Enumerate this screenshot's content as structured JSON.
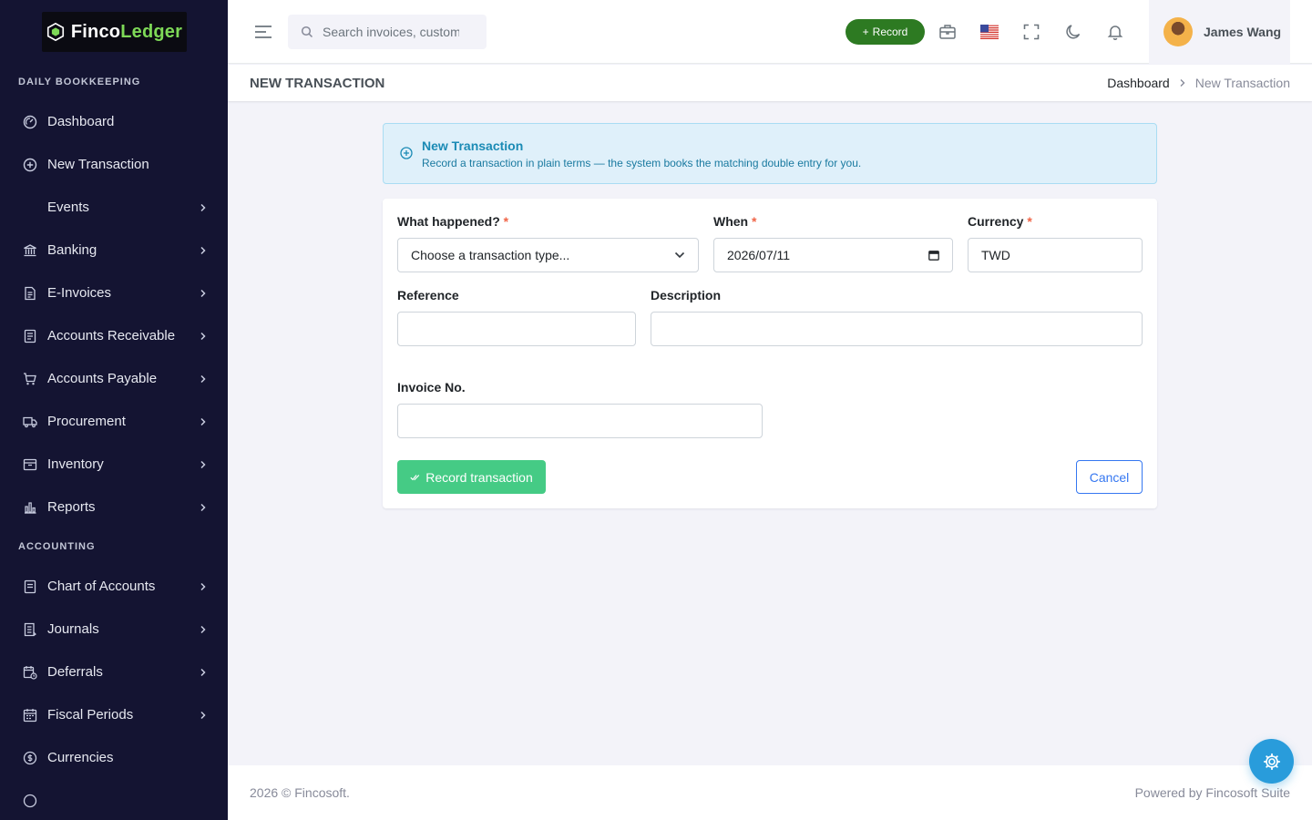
{
  "brand": {
    "name_part1": "Finco",
    "name_part2": "Ledger"
  },
  "sidebar": {
    "section_daily": "Daily Bookkeeping",
    "section_accounting": "Accounting",
    "items": [
      {
        "label": "Dashboard",
        "icon": "dashboard-icon"
      },
      {
        "label": "New Transaction",
        "icon": "plus-circle-icon"
      },
      {
        "label": "Events",
        "icon": ""
      },
      {
        "label": "Banking",
        "icon": "bank-icon"
      },
      {
        "label": "E-Invoices",
        "icon": "document-icon"
      },
      {
        "label": "Accounts Receivable",
        "icon": "receipt-icon"
      },
      {
        "label": "Accounts Payable",
        "icon": "cart-icon"
      },
      {
        "label": "Procurement",
        "icon": "truck-icon"
      },
      {
        "label": "Inventory",
        "icon": "archive-icon"
      },
      {
        "label": "Reports",
        "icon": "bar-chart-icon"
      },
      {
        "label": "Chart of Accounts",
        "icon": "ledger-icon"
      },
      {
        "label": "Journals",
        "icon": "journal-icon"
      },
      {
        "label": "Deferrals",
        "icon": "calendar-clock-icon"
      },
      {
        "label": "Fiscal Periods",
        "icon": "calendar-icon"
      },
      {
        "label": "Currencies",
        "icon": "coin-icon"
      }
    ]
  },
  "topbar": {
    "search_placeholder": "Search invoices, customers...",
    "record_label": "Record",
    "user_name": "James Wang"
  },
  "page": {
    "title": "New Transaction",
    "breadcrumb_home": "Dashboard",
    "breadcrumb_current": "New Transaction"
  },
  "alert": {
    "title": "New Transaction",
    "text": "Record a transaction in plain terms — the system books the matching double entry for you."
  },
  "form": {
    "what_label": "What happened?",
    "what_value": "Choose a transaction type...",
    "when_label": "When",
    "when_value": "2026/07/11",
    "currency_label": "Currency",
    "currency_value": "TWD",
    "reference_label": "Reference",
    "description_label": "Description",
    "invoice_label": "Invoice No.",
    "required_mark": "*",
    "submit_label": "Record transaction",
    "cancel_label": "Cancel"
  },
  "footer": {
    "copyright": "2026 © Fincosoft.",
    "powered": "Powered by Fincosoft Suite"
  },
  "colors": {
    "sidebar_bg": "#141432",
    "brand_accent": "#7ed957",
    "record_button": "#2d7a22",
    "submit_button": "#45cb85",
    "alert_bg": "#dff0fa",
    "fab": "#299cdb"
  }
}
